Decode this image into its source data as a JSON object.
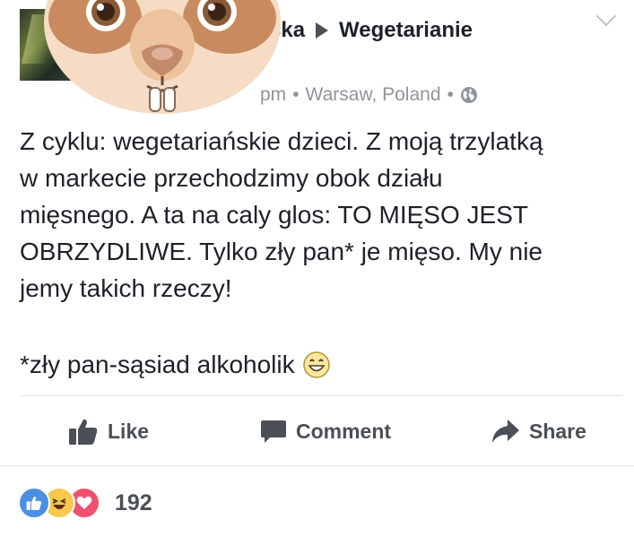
{
  "header": {
    "author_partial": "ska",
    "group_name": "Wegetarianie",
    "time_partial": "pm",
    "location": "Warsaw, Poland",
    "separator": "•"
  },
  "post": {
    "lines": [
      "Z cyklu: wegetariańskie dzieci. Z moją trzylatką",
      "w markecie przechodzimy obok działu",
      "mięsnego. A ta na caly glos: TO MIĘSO JEST",
      "OBRZYDLIWE. Tylko zły pan* je mięso. My nie",
      "jemy takich rzeczy!"
    ],
    "footnote": "*zły pan-sąsiad alkoholik"
  },
  "actions": {
    "like": "Like",
    "comment": "Comment",
    "share": "Share"
  },
  "reactions": {
    "count": "192",
    "types": [
      "like-icon",
      "haha-icon",
      "love-icon"
    ],
    "colors": {
      "like": "#4a90e2",
      "haha": "#f7c84b",
      "love": "#f0506e"
    }
  },
  "icons": [
    "avatar",
    "arrow-right-icon",
    "chevron-down-icon",
    "globe-icon",
    "grinning-emoji-icon",
    "thumbs-up-icon",
    "comment-bubble-icon",
    "share-arrow-icon"
  ]
}
